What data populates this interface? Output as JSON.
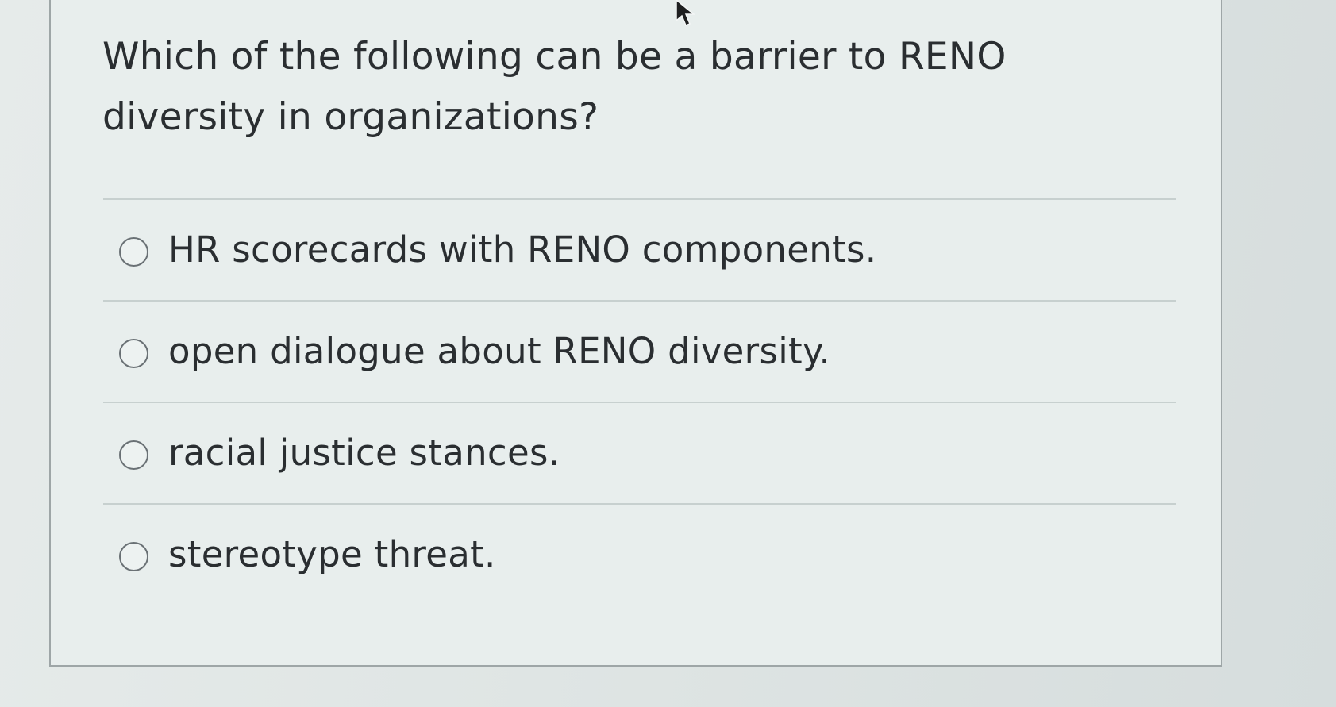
{
  "question": {
    "text": "Which of the following can be a barrier to RENO diversity in organizations?"
  },
  "answers": [
    {
      "label": "HR scorecards with RENO components.",
      "selected": false
    },
    {
      "label": "open dialogue about RENO diversity.",
      "selected": false
    },
    {
      "label": "racial justice stances.",
      "selected": false
    },
    {
      "label": "stereotype threat.",
      "selected": false
    }
  ],
  "icons": {
    "radio": "radio-button-icon",
    "cursor": "mouse-pointer-icon"
  },
  "colors": {
    "background": "#dde3e2",
    "card": "#e8eeed",
    "text": "#2a2e31",
    "divider": "#c7d0cf"
  }
}
